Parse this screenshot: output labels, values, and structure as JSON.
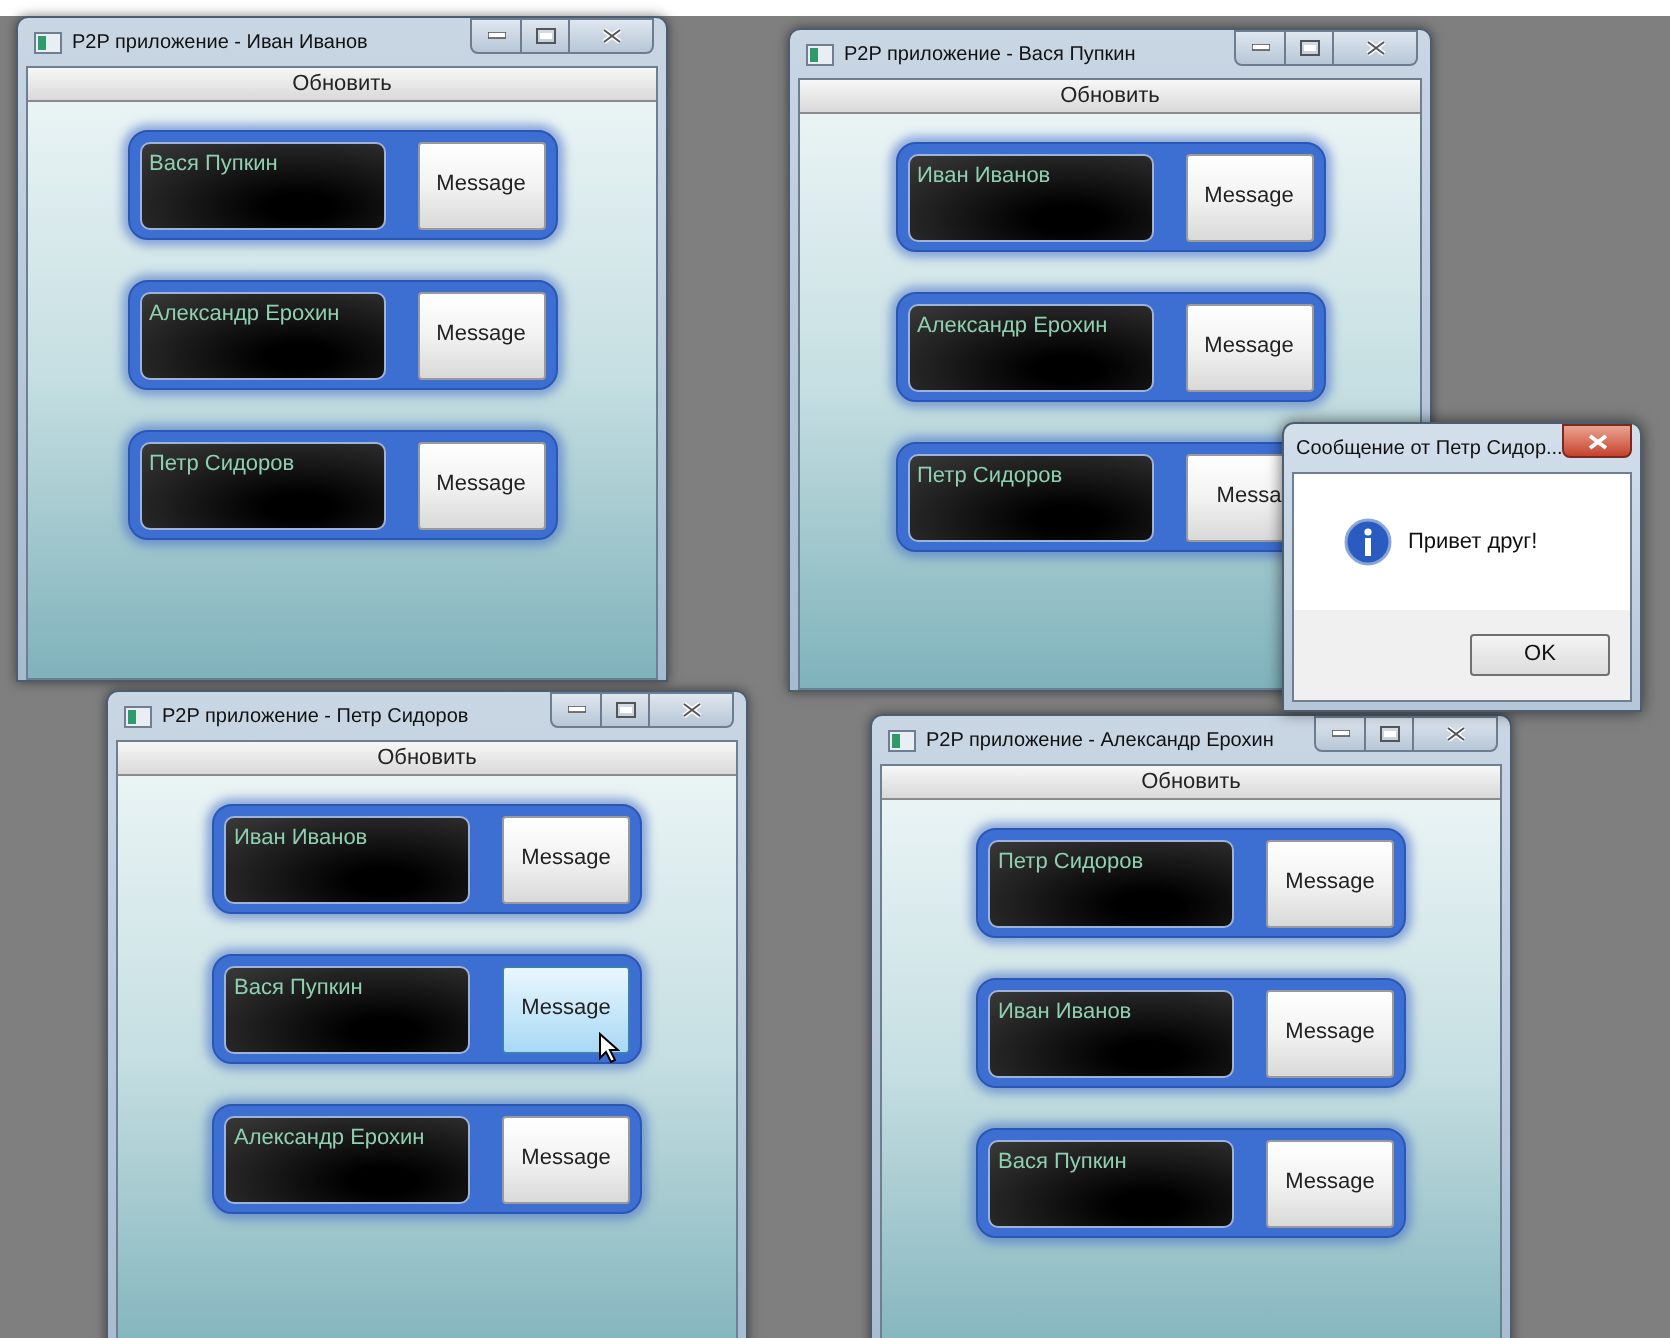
{
  "windows": [
    {
      "title": "P2P приложение - Иван Иванов",
      "refresh": "Обновить",
      "contacts": [
        {
          "name": "Вася Пупкин",
          "button": "Message",
          "highlighted": false
        },
        {
          "name": "Александр Ерохин",
          "button": "Message",
          "highlighted": false
        },
        {
          "name": "Петр Сидоров",
          "button": "Message",
          "highlighted": false
        }
      ]
    },
    {
      "title": "P2P приложение - Вася Пупкин",
      "refresh": "Обновить",
      "contacts": [
        {
          "name": "Иван Иванов",
          "button": "Message",
          "highlighted": false
        },
        {
          "name": "Александр Ерохин",
          "button": "Message",
          "highlighted": false
        },
        {
          "name": "Петр Сидоров",
          "button": "Messa",
          "highlighted": false
        }
      ]
    },
    {
      "title": "P2P приложение - Петр Сидоров",
      "refresh": "Обновить",
      "contacts": [
        {
          "name": "Иван Иванов",
          "button": "Message",
          "highlighted": false
        },
        {
          "name": "Вася Пупкин",
          "button": "Message",
          "highlighted": true
        },
        {
          "name": "Александр Ерохин",
          "button": "Message",
          "highlighted": false
        }
      ]
    },
    {
      "title": "P2P приложение - Александр Ерохин",
      "refresh": "Обновить",
      "contacts": [
        {
          "name": "Петр Сидоров",
          "button": "Message",
          "highlighted": false
        },
        {
          "name": "Иван Иванов",
          "button": "Message",
          "highlighted": false
        },
        {
          "name": "Вася Пупкин",
          "button": "Message",
          "highlighted": false
        }
      ]
    }
  ],
  "dialog": {
    "title": "Сообщение от Петр Сидор...",
    "message": "Привет друг!",
    "ok": "OK"
  }
}
